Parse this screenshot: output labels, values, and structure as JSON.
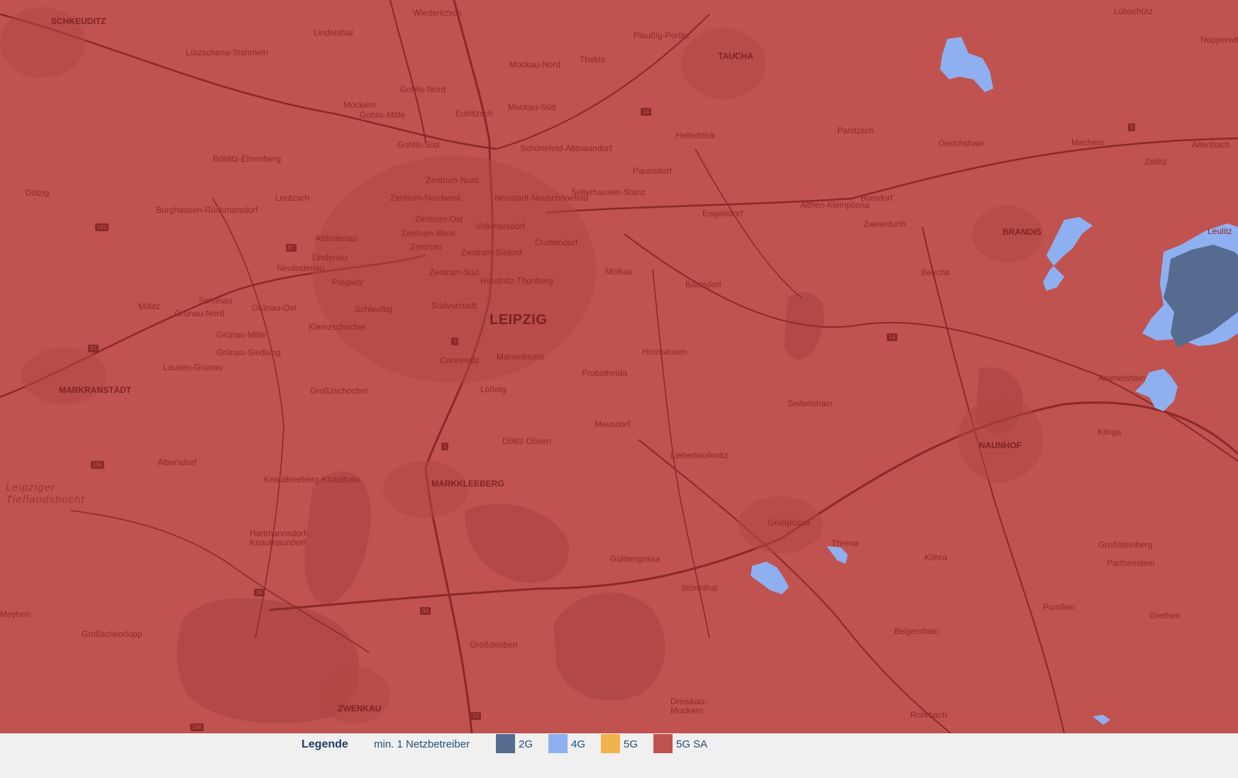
{
  "map": {
    "places": [
      {
        "id": "schkeuditz",
        "label": "SCHKEUDITZ",
        "kind": "town"
      },
      {
        "id": "wiederitzsch",
        "label": "Wiederitzsch",
        "kind": "place"
      },
      {
        "id": "lindenthal",
        "label": "Lindenthal",
        "kind": "place"
      },
      {
        "id": "lutzschena",
        "label": "Lützschena-Stahmeln",
        "kind": "place"
      },
      {
        "id": "plaussig",
        "label": "Plaußig-Portitz",
        "kind": "place"
      },
      {
        "id": "taucha",
        "label": "TAUCHA",
        "kind": "town"
      },
      {
        "id": "mockau",
        "label": "Mockau-Nord",
        "kind": "place"
      },
      {
        "id": "thekla",
        "label": "Thekla",
        "kind": "place"
      },
      {
        "id": "gohlis-nord",
        "label": "Gohlis-Nord",
        "kind": "place"
      },
      {
        "id": "mockern",
        "label": "Möckern",
        "kind": "place"
      },
      {
        "id": "gohlis-mitte",
        "label": "Gohlis-Mitte",
        "kind": "place"
      },
      {
        "id": "eutritzsch",
        "label": "Eutritzsch",
        "kind": "place"
      },
      {
        "id": "mockau-sud",
        "label": "Mockau-Süd",
        "kind": "place"
      },
      {
        "id": "gohlis-sud",
        "label": "Gohlis-Süd",
        "kind": "place"
      },
      {
        "id": "schonefeld",
        "label": "Schönefeld-Abtnaundorf",
        "kind": "place"
      },
      {
        "id": "heiterblick",
        "label": "Heiterblick",
        "kind": "place"
      },
      {
        "id": "paunsdorf",
        "label": "Paunsdorf",
        "kind": "place"
      },
      {
        "id": "bohlitz",
        "label": "Böhlitz-Ehrenberg",
        "kind": "place"
      },
      {
        "id": "zentrum-nord",
        "label": "Zentrum-Nord",
        "kind": "place"
      },
      {
        "id": "dolzig",
        "label": "Dölzig",
        "kind": "place"
      },
      {
        "id": "leutzsch",
        "label": "Leutzsch",
        "kind": "place"
      },
      {
        "id": "zentrum-nordwest",
        "label": "Zentrum-Nordwest",
        "kind": "place"
      },
      {
        "id": "neustadt",
        "label": "Neustadt-Neuschönefeld",
        "kind": "place"
      },
      {
        "id": "sellerhausen",
        "label": "Sellerhausen-Stünz",
        "kind": "place"
      },
      {
        "id": "engelsdorf",
        "label": "Engelsdorf",
        "kind": "place"
      },
      {
        "id": "althen",
        "label": "Althen-Kleinpösna",
        "kind": "place"
      },
      {
        "id": "borsdorf",
        "label": "Borsdorf",
        "kind": "place"
      },
      {
        "id": "burghausen",
        "label": "Burghausen-Rückmarsdorf",
        "kind": "place"
      },
      {
        "id": "zentrum-ost",
        "label": "Zentrum-Ost",
        "kind": "place"
      },
      {
        "id": "zentrum-west",
        "label": "Zentrum-West",
        "kind": "place"
      },
      {
        "id": "volkmarsdorf",
        "label": "Volkmarsdorf",
        "kind": "place"
      },
      {
        "id": "altlindenau",
        "label": "Altlindenau",
        "kind": "place"
      },
      {
        "id": "zentrum",
        "label": "Zentrum",
        "kind": "place"
      },
      {
        "id": "crottendorf",
        "label": "Crottendorf",
        "kind": "place"
      },
      {
        "id": "zweenfurth",
        "label": "Zweenfurth",
        "kind": "place"
      },
      {
        "id": "lindenau",
        "label": "Lindenau",
        "kind": "place"
      },
      {
        "id": "zentrum-sudost",
        "label": "Zentrum-Südost",
        "kind": "place"
      },
      {
        "id": "neulindenau",
        "label": "Neulindenau",
        "kind": "place"
      },
      {
        "id": "zentrum-sud",
        "label": "Zentrum-Süd",
        "kind": "place"
      },
      {
        "id": "molkau",
        "label": "Mölkau",
        "kind": "place"
      },
      {
        "id": "plagwitz",
        "label": "Plagwitz",
        "kind": "place"
      },
      {
        "id": "reudnitz",
        "label": "Reudnitz-Thonberg",
        "kind": "place"
      },
      {
        "id": "baalsdorf",
        "label": "Baalsdorf",
        "kind": "place"
      },
      {
        "id": "schonau",
        "label": "Schönau",
        "kind": "place"
      },
      {
        "id": "miltitz",
        "label": "Miltitz",
        "kind": "place"
      },
      {
        "id": "grunau-ost",
        "label": "Grünau-Ost",
        "kind": "place"
      },
      {
        "id": "schlussig",
        "label": "Schleußig",
        "kind": "place"
      },
      {
        "id": "sudvorstadt",
        "label": "Südvorstadt",
        "kind": "place"
      },
      {
        "id": "leipzig",
        "label": "LEIPZIG",
        "kind": "city"
      },
      {
        "id": "grunau-nord",
        "label": "Grünau-Nord",
        "kind": "place"
      },
      {
        "id": "kleinzschocher",
        "label": "Kleinzschocher",
        "kind": "place"
      },
      {
        "id": "grunau-mitte",
        "label": "Grünau-Mitte",
        "kind": "place"
      },
      {
        "id": "grunau-siedlung",
        "label": "Grünau-Siedlung",
        "kind": "place"
      },
      {
        "id": "marienbrunn",
        "label": "Marienbrunn",
        "kind": "place"
      },
      {
        "id": "holzhausen",
        "label": "Holzhausen",
        "kind": "place"
      },
      {
        "id": "connewitz",
        "label": "Connewitz",
        "kind": "place"
      },
      {
        "id": "lausen",
        "label": "Lausen-Grünau",
        "kind": "place"
      },
      {
        "id": "probstheida",
        "label": "Probstheida",
        "kind": "place"
      },
      {
        "id": "markranstadt",
        "label": "MARKRANSTÄDT",
        "kind": "town"
      },
      {
        "id": "grosszschocher",
        "label": "Großzschocher",
        "kind": "place"
      },
      {
        "id": "lossnig",
        "label": "Lößnig",
        "kind": "place"
      },
      {
        "id": "seifertshain",
        "label": "Seifertshain",
        "kind": "place"
      },
      {
        "id": "meusdorf",
        "label": "Meusdorf",
        "kind": "place"
      },
      {
        "id": "dolitz",
        "label": "Dölitz-Dösen",
        "kind": "place"
      },
      {
        "id": "naunhof",
        "label": "NAUNHOF",
        "kind": "town"
      },
      {
        "id": "liebertwolkwitz",
        "label": "Liebertwolkwitz",
        "kind": "place"
      },
      {
        "id": "albersdorf",
        "label": "Albersdorf",
        "kind": "place"
      },
      {
        "id": "knautkleeberg",
        "label": "Knautkleeberg-Knauthain",
        "kind": "place"
      },
      {
        "id": "markkleeberg",
        "label": "MARKKLEEBERG",
        "kind": "town"
      },
      {
        "id": "leipziger",
        "label": "Leipziger Tieflandsbucht",
        "kind": "region"
      },
      {
        "id": "grosspoesna",
        "label": "Großpösna",
        "kind": "place"
      },
      {
        "id": "hartmannsdorf",
        "label": "Hartmannsdorf-Knautnaundorf",
        "kind": "place"
      },
      {
        "id": "guldengossa",
        "label": "Güldengossa",
        "kind": "place"
      },
      {
        "id": "thrana",
        "label": "Threna",
        "kind": "place"
      },
      {
        "id": "stormthal",
        "label": "Störmthal",
        "kind": "place"
      },
      {
        "id": "grosssteinberg",
        "label": "Großsteinberg",
        "kind": "place"
      },
      {
        "id": "parthenstein",
        "label": "Parthenstein",
        "kind": "place"
      },
      {
        "id": "meyhen",
        "label": "Meyhen",
        "kind": "place"
      },
      {
        "id": "grosschkorlopp",
        "label": "Großschkorlopp",
        "kind": "place"
      },
      {
        "id": "belgershain",
        "label": "Belgershain",
        "kind": "place"
      },
      {
        "id": "grossdeuben",
        "label": "Großdeuben",
        "kind": "place"
      },
      {
        "id": "dreiskau",
        "label": "Dreiskau-Muckern",
        "kind": "place"
      },
      {
        "id": "zwenkau",
        "label": "ZWENKAU",
        "kind": "town"
      },
      {
        "id": "rohrbach",
        "label": "Rohrbach",
        "kind": "place"
      },
      {
        "id": "machern",
        "label": "Machern",
        "kind": "place"
      },
      {
        "id": "brandis",
        "label": "BRANDIS",
        "kind": "town"
      },
      {
        "id": "beucha",
        "label": "Beucha",
        "kind": "place"
      },
      {
        "id": "leulitz",
        "label": "Leulitz",
        "kind": "place"
      },
      {
        "id": "ammelshain",
        "label": "Ammelshain",
        "kind": "place"
      },
      {
        "id": "klinga",
        "label": "Klinga",
        "kind": "place"
      },
      {
        "id": "panitzsch",
        "label": "Panitzsch",
        "kind": "place"
      },
      {
        "id": "gerichshain",
        "label": "Gerichshain",
        "kind": "place"
      },
      {
        "id": "altenbach",
        "label": "Altenbach",
        "kind": "place"
      },
      {
        "id": "zeititz",
        "label": "Zeititz",
        "kind": "place"
      },
      {
        "id": "nopperwitz",
        "label": "Nopperwitz",
        "kind": "place"
      },
      {
        "id": "lubschutz",
        "label": "Lübschütz",
        "kind": "place"
      },
      {
        "id": "pomssen",
        "label": "Pomßen",
        "kind": "place"
      },
      {
        "id": "grethen",
        "label": "Grethen",
        "kind": "place"
      },
      {
        "id": "kohra",
        "label": "Köhra",
        "kind": "place"
      }
    ],
    "road_numbers": [
      "14",
      "186",
      "181",
      "87",
      "2",
      "38",
      "72",
      "6",
      "87",
      "186",
      "38",
      "2",
      "14"
    ],
    "colors": {
      "background_5g_sa": "#c0524f",
      "coverage_4g": "#8fb0f0",
      "coverage_2g": "#566b90",
      "roads": "#8a2a27"
    }
  },
  "legend": {
    "title": "Legende",
    "subtitle": "min. 1 Netzbetreiber",
    "items": [
      {
        "label": "2G",
        "color": "#566b90"
      },
      {
        "label": "4G",
        "color": "#8fb0f0"
      },
      {
        "label": "5G",
        "color": "#f2b34d"
      },
      {
        "label": "5G SA",
        "color": "#c0524f"
      }
    ]
  }
}
